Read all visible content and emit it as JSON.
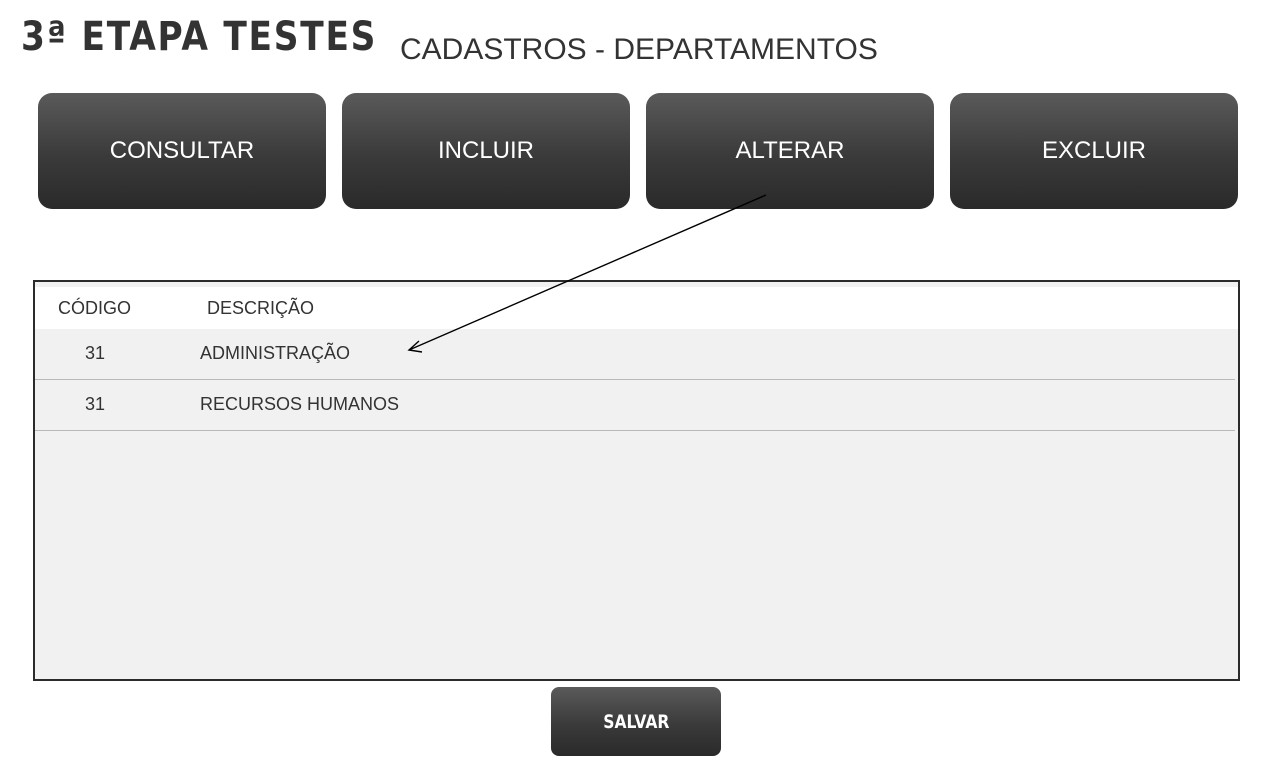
{
  "header": {
    "brand": "3ª ETAPA TESTES",
    "title": "CADASTROS - DEPARTAMENTOS"
  },
  "actions": {
    "consultar": "CONSULTAR",
    "incluir": "INCLUIR",
    "alterar": "ALTERAR",
    "excluir": "EXCLUIR"
  },
  "table": {
    "columns": [
      "CÓDIGO",
      "DESCRIÇÃO"
    ],
    "rows": [
      {
        "code": "31",
        "description": "ADMINISTRAÇÃO"
      },
      {
        "code": "31",
        "description": "RECURSOS HUMANOS"
      }
    ]
  },
  "footer": {
    "save_label": "SALVAR"
  },
  "colors": {
    "button_dark": "#3a3a3a",
    "text_dark": "#333333",
    "table_bg": "#f1f1f1",
    "border": "#2b2b2b"
  },
  "icons": {
    "annotation": "arrow-icon"
  }
}
